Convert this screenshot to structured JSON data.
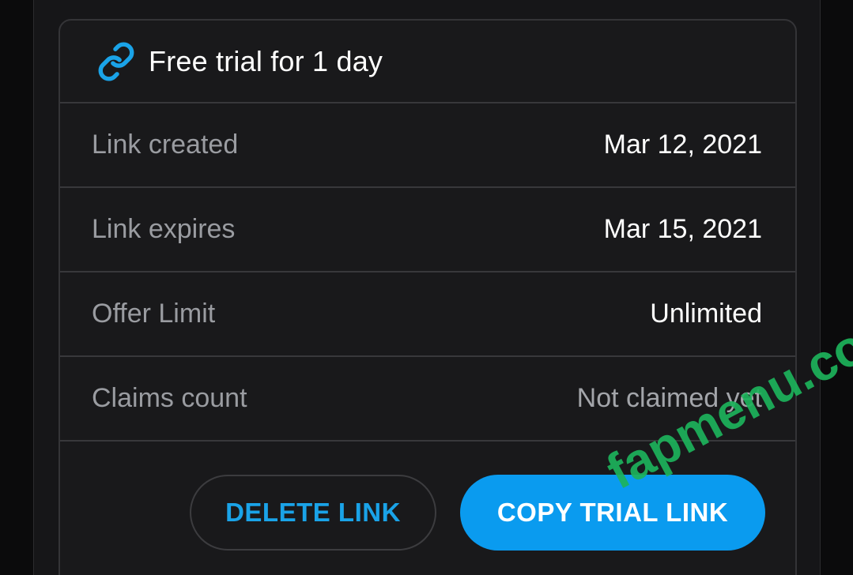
{
  "card": {
    "title": "Free trial for 1 day",
    "icon": "link-icon",
    "accent_color": "#1aa3e8"
  },
  "details": [
    {
      "label": "Link created",
      "value": "Mar 12, 2021"
    },
    {
      "label": "Link expires",
      "value": "Mar 15, 2021"
    },
    {
      "label": "Offer Limit",
      "value": "Unlimited"
    },
    {
      "label": "Claims count",
      "value": "Not claimed yet"
    }
  ],
  "actions": {
    "delete_label": "DELETE LINK",
    "copy_label": "COPY TRIAL LINK",
    "copy_color": "#0a9bef"
  },
  "watermark": {
    "text": "fapmenu.com",
    "color": "#1db35b"
  }
}
